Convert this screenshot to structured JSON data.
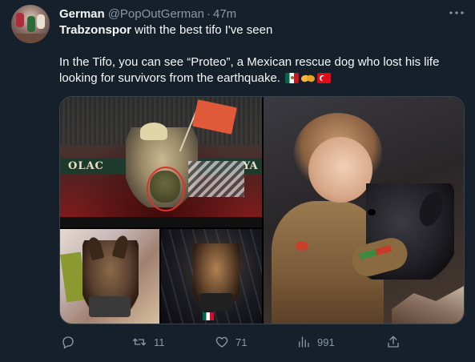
{
  "tweet": {
    "author": {
      "name": "German",
      "handle": "@PopOutGerman",
      "separator": "·",
      "time": "47m"
    },
    "text": {
      "mention": "Trabzonspor",
      "line1_rest": " with the best tifo I've seen",
      "paragraph": "In the Tifo, you can see “Proteo”, a Mexican rescue dog who lost his life looking for survivors from the earthquake."
    },
    "emojis": [
      "mexico-flag",
      "handshake",
      "turkey-flag"
    ],
    "media": {
      "tifo_left_text": "OLAC",
      "tifo_right_text": "YA"
    },
    "stats": {
      "replies": "",
      "retweets": "11",
      "likes": "71",
      "views": "991"
    }
  },
  "colors": {
    "background": "#15202b",
    "text_primary": "#f7f9f9",
    "text_secondary": "#8b98a5",
    "border": "#38444d"
  },
  "icons": {
    "more": "more-icon",
    "reply": "reply-icon",
    "retweet": "retweet-icon",
    "like": "heart-icon",
    "views": "views-icon",
    "share": "share-icon"
  }
}
